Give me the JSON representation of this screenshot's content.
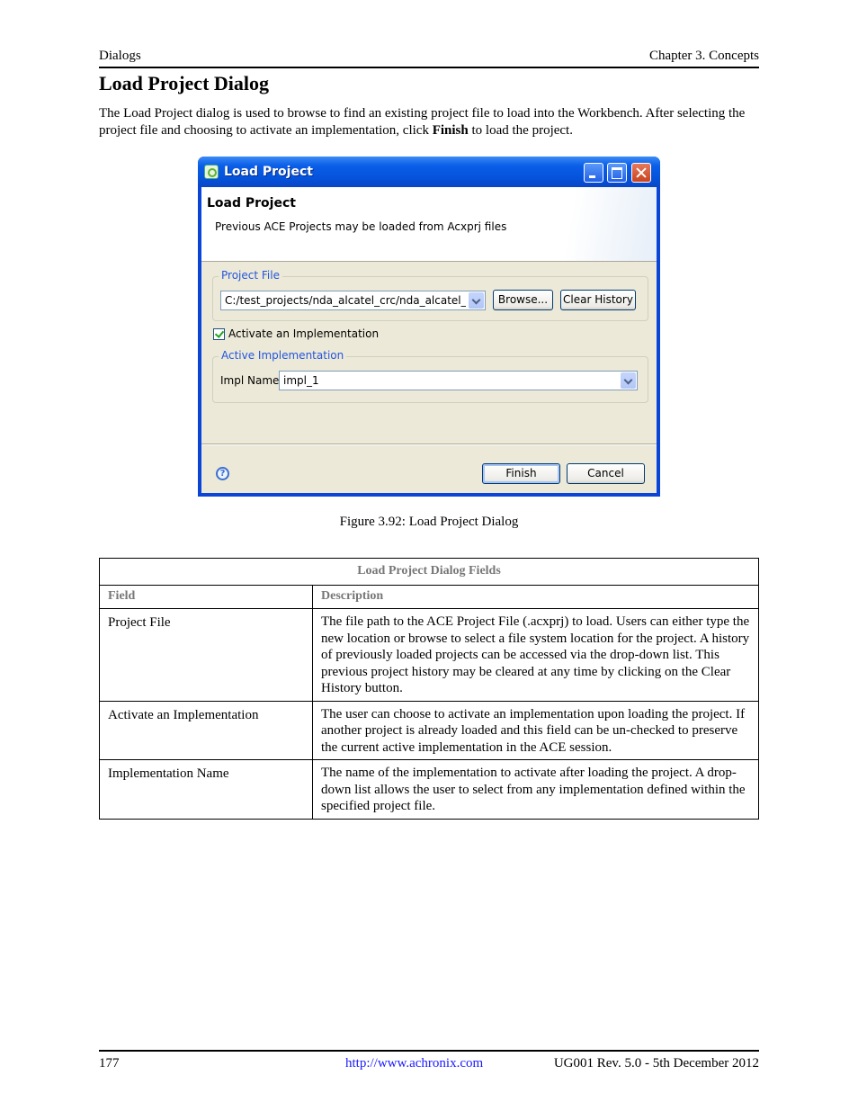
{
  "page_header": {
    "left": "Dialogs",
    "right": "Chapter 3. Concepts"
  },
  "section_title": "Load Project Dialog",
  "intro": {
    "before": "The Load Project dialog is used to browse to find an existing project file to load into the Workbench.  After selecting the project file and choosing to activate an implementation, click ",
    "bold": "Finish",
    "after": " to load the project."
  },
  "dialog": {
    "window_title": "Load Project",
    "banner_title": "Load Project",
    "banner_message": "Previous ACE Projects may be loaded from Acxprj files",
    "project_file_group": "Project File",
    "project_file_value": "C:/test_projects/nda_alcatel_crc/nda_alcatel_crc.acxprj",
    "browse_label": "Browse...",
    "clear_history_label": "Clear History",
    "activate_checkbox_label": "Activate an Implementation",
    "activate_checked": true,
    "active_impl_group": "Active Implementation",
    "impl_name_label": "Impl Name",
    "impl_name_value": "impl_1",
    "help_glyph": "?",
    "finish_label": "Finish",
    "cancel_label": "Cancel"
  },
  "figure_caption": "Figure 3.92: Load Project Dialog",
  "table": {
    "caption": "Load Project Dialog Fields",
    "headers": [
      "Field",
      "Description"
    ],
    "rows": [
      {
        "field": "Project File",
        "description": "The file path to the ACE Project File (.acxprj) to load. Users can either type the new location or browse to select a file system location for the project.  A history of previously loaded projects can be accessed via the drop-down list. This previous project history may be cleared at any time by clicking on the Clear History button."
      },
      {
        "field": "Activate an Implementation",
        "description": "The user can choose to activate an implementation upon loading the project. If another project is already loaded and this field can be un-checked to preserve the current active implementation in the ACE session."
      },
      {
        "field": "Implementation Name",
        "description": "The name of the implementation to activate after loading the project. A drop-down list allows the user to select from any implementation defined within the specified project file."
      }
    ]
  },
  "page_footer": {
    "page_number": "177",
    "url": "http://www.achronix.com",
    "revision": "UG001 Rev. 5.0 - 5th December 2012"
  }
}
